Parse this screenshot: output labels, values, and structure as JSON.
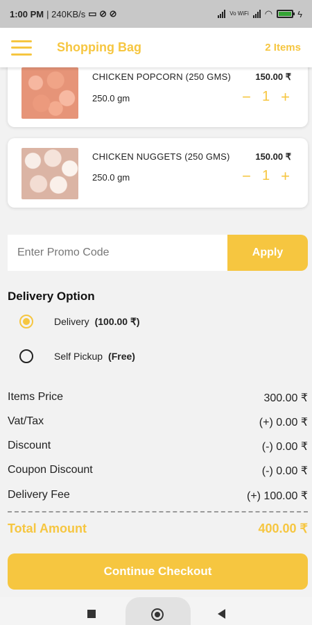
{
  "status_bar": {
    "time": "1:00 PM",
    "speed": "| 240KB/s",
    "network": "Vo WiFi"
  },
  "header": {
    "title": "Shopping Bag",
    "item_count": "2 Items",
    "menu_icon": "hamburger-menu-icon"
  },
  "cart": {
    "items": [
      {
        "name": "CHICKEN POPCORN (250 GMS)",
        "weight": "250.0 gm",
        "price": "150.00 ₹",
        "quantity": "1",
        "minus": "−",
        "plus": "+"
      },
      {
        "name": "CHICKEN NUGGETS (250 GMS)",
        "weight": "250.0 gm",
        "price": "150.00 ₹",
        "quantity": "1",
        "minus": "−",
        "plus": "+"
      }
    ]
  },
  "promo": {
    "placeholder": "Enter Promo Code",
    "value": "",
    "apply_label": "Apply"
  },
  "delivery": {
    "heading": "Delivery Option",
    "options": [
      {
        "label": "Delivery",
        "sub": "(100.00 ₹)",
        "selected": true
      },
      {
        "label": "Self Pickup",
        "sub": "(Free)",
        "selected": false
      }
    ]
  },
  "summary": {
    "rows": [
      {
        "label": "Items Price",
        "value": "300.00 ₹"
      },
      {
        "label": "Vat/Tax",
        "value": "(+) 0.00 ₹"
      },
      {
        "label": "Discount",
        "value": "(-) 0.00 ₹"
      },
      {
        "label": "Coupon Discount",
        "value": "(-) 0.00 ₹"
      },
      {
        "label": "Delivery Fee",
        "value": "(+) 100.00 ₹"
      }
    ],
    "total_label": "Total Amount",
    "total_value": "400.00 ₹"
  },
  "checkout": {
    "label": "Continue Checkout"
  },
  "colors": {
    "accent": "#f6c640",
    "background": "#f2f2f2",
    "card": "#ffffff"
  }
}
